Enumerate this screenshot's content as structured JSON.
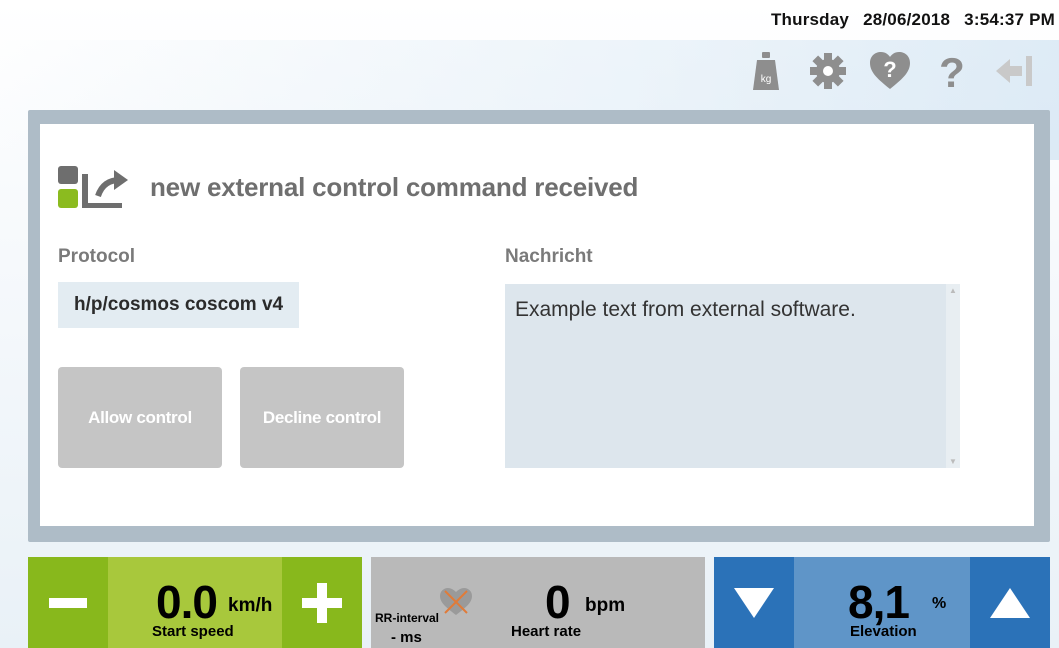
{
  "header": {
    "day": "Thursday",
    "date": "28/06/2018",
    "time": "3:54:37 PM"
  },
  "toolbar": {
    "icons": [
      "weight-kg-icon",
      "gear-icon",
      "heart-question-icon",
      "help-icon",
      "exit-icon"
    ],
    "weight_label": "kg"
  },
  "dialog": {
    "title": "new external control command received",
    "protocol_label": "Protocol",
    "protocol_value": "h/p/cosmos coscom v4",
    "message_label": "Nachricht",
    "message_value": "Example text from external software.",
    "allow_label": "Allow control",
    "decline_label": "Decline control"
  },
  "speed": {
    "value": "0.0",
    "unit": "km/h",
    "label": "Start speed"
  },
  "heart": {
    "value": "0",
    "unit": "bpm",
    "label": "Heart rate",
    "rr_label": "RR-interval",
    "rr_value": "-  ms"
  },
  "elevation": {
    "value": "8,1",
    "unit": "%",
    "label": "Elevation"
  },
  "colors": {
    "speed_panel": "#a8c83c",
    "speed_button": "#88b81c",
    "heart_panel": "#b9b9b9",
    "elevation_panel": "#5f95c8",
    "elevation_button": "#2b72b8",
    "dialog_frame": "#aebcc7"
  }
}
